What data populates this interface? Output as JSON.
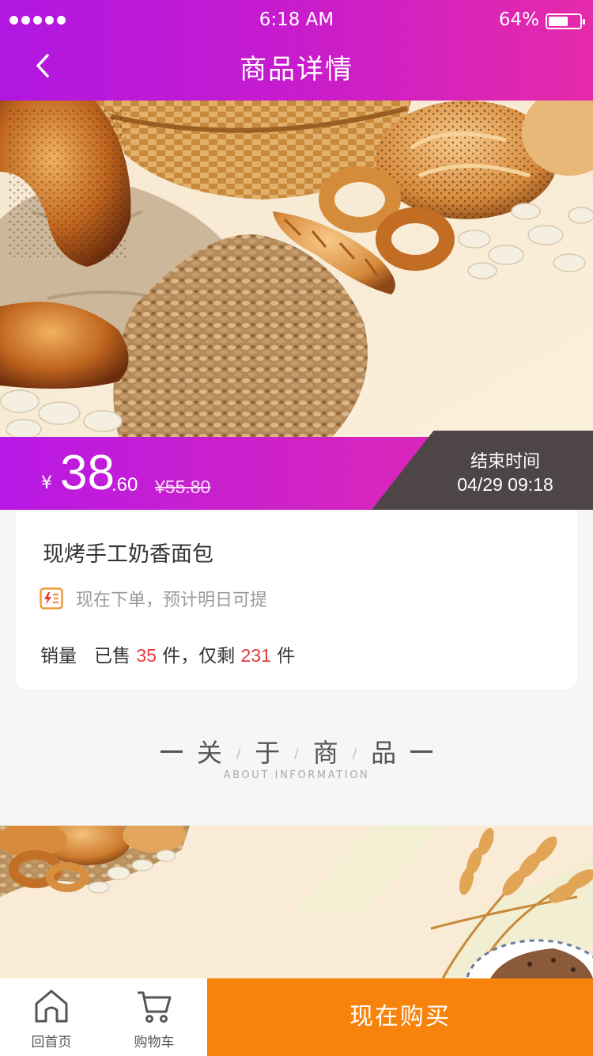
{
  "status_bar": {
    "time": "6:18 AM",
    "battery_percent_text": "64%",
    "battery_level": 0.64
  },
  "header": {
    "title": "商品详情",
    "back_icon": "chevron-left-icon"
  },
  "hero_image": {
    "subject": "bread-and-oats-photo"
  },
  "price": {
    "currency": "¥",
    "integer": "38",
    "decimal": ".60",
    "original": "¥55.80"
  },
  "countdown": {
    "label": "结束时间",
    "time": "04/29 09:18"
  },
  "product": {
    "name": "现烤手工奶香面包",
    "delivery_icon": "flash-delivery-icon",
    "delivery_note": "现在下单，预计明日可提",
    "sales_label": "销量",
    "sold_prefix": "已售",
    "sold_count": "35",
    "sold_suffix": "件，仅剩",
    "remaining_count": "231",
    "remaining_suffix": "件"
  },
  "about": {
    "chars": [
      "关",
      "于",
      "商",
      "品"
    ],
    "subtitle": "ABOUT   INFORMATION"
  },
  "bottom_bar": {
    "home_label": "回首页",
    "home_icon": "home-icon",
    "cart_label": "购物车",
    "cart_icon": "cart-icon",
    "buy_label": "现在购买"
  },
  "colors": {
    "header_gradient_start": "#b117e0",
    "header_gradient_end": "#e52aa9",
    "countdown_bg": "#4e4546",
    "highlight_red": "#e8393a",
    "buy_button": "#f7830c"
  }
}
